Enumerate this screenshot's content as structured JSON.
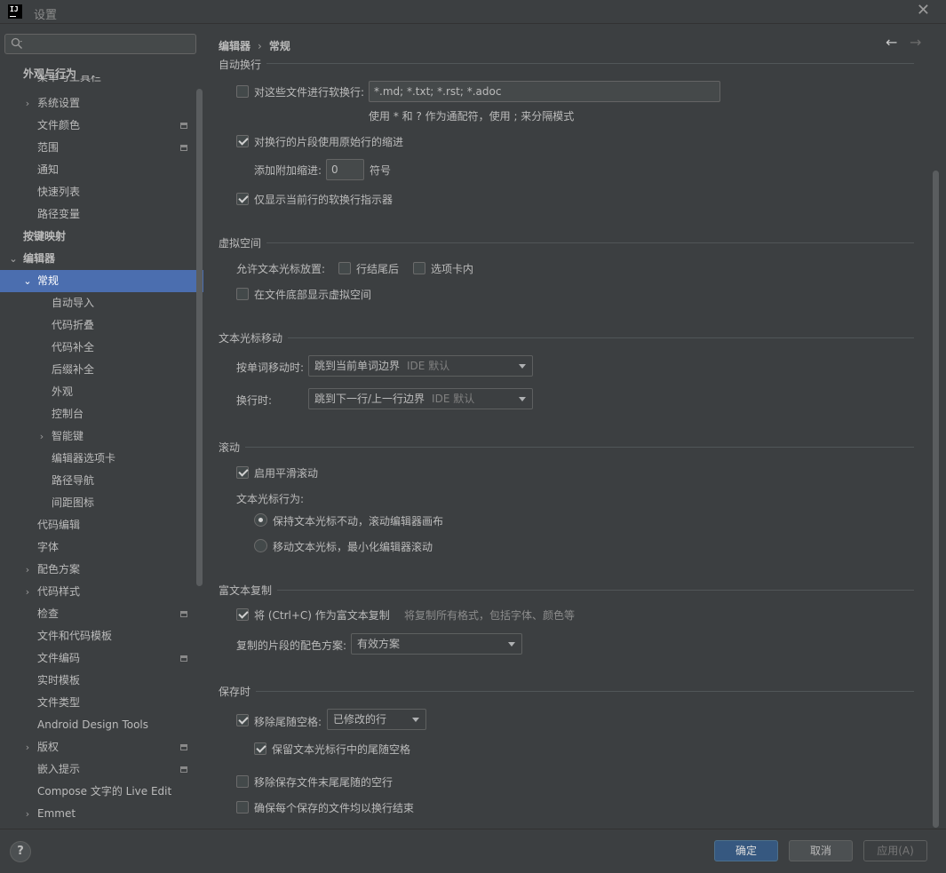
{
  "window": {
    "title": "设置",
    "logo_text": "IJ"
  },
  "search": {
    "placeholder": ""
  },
  "sidebar": {
    "sticky_header": "外观与行为",
    "clipped_item": "菜单与工具栏",
    "items": [
      {
        "label": "系统设置"
      },
      {
        "label": "文件颜色"
      },
      {
        "label": "范围"
      },
      {
        "label": "通知"
      },
      {
        "label": "快速列表"
      },
      {
        "label": "路径变量"
      },
      {
        "label": "按键映射"
      },
      {
        "label": "编辑器"
      },
      {
        "label": "常规"
      },
      {
        "label": "自动导入"
      },
      {
        "label": "代码折叠"
      },
      {
        "label": "代码补全"
      },
      {
        "label": "后缀补全"
      },
      {
        "label": "外观"
      },
      {
        "label": "控制台"
      },
      {
        "label": "智能键"
      },
      {
        "label": "编辑器选项卡"
      },
      {
        "label": "路径导航"
      },
      {
        "label": "间距图标"
      },
      {
        "label": "代码编辑"
      },
      {
        "label": "字体"
      },
      {
        "label": "配色方案"
      },
      {
        "label": "代码样式"
      },
      {
        "label": "检查"
      },
      {
        "label": "文件和代码模板"
      },
      {
        "label": "文件编码"
      },
      {
        "label": "实时模板"
      },
      {
        "label": "文件类型"
      },
      {
        "label": "Android Design Tools"
      },
      {
        "label": "版权"
      },
      {
        "label": "嵌入提示"
      },
      {
        "label": "Compose 文字的 Live Edit"
      },
      {
        "label": "Emmet"
      }
    ]
  },
  "breadcrumb": {
    "parent": "编辑器",
    "separator": "›",
    "current": "常规"
  },
  "nav": {
    "back": "←",
    "forward": "→"
  },
  "soft_wrap": {
    "title": "自动换行",
    "wrap_files_label": "对这些文件进行软换行:",
    "wrap_files_checked": false,
    "wrap_files_value": "*.md; *.txt; *.rst; *.adoc",
    "wrap_files_hint": "使用 * 和 ? 作为通配符，使用 ; 来分隔模式",
    "use_original_indent_label": "对换行的片段使用原始行的缩进",
    "use_original_indent_checked": true,
    "extra_indent_label": "添加附加缩进:",
    "extra_indent_value": "0",
    "extra_indent_unit": "符号",
    "show_indicator_label": "仅显示当前行的软换行指示器",
    "show_indicator_checked": true
  },
  "virtual_space": {
    "title": "虚拟空间",
    "allow_caret_label": "允许文本光标放置:",
    "after_line_end_label": "行结尾后",
    "after_line_end_checked": false,
    "inside_tabs_label": "选项卡内",
    "inside_tabs_checked": false,
    "show_at_bottom_label": "在文件底部显示虚拟空间",
    "show_at_bottom_checked": false
  },
  "caret_movement": {
    "title": "文本光标移动",
    "word_move_label": "按单词移动时:",
    "word_move_value": "跳到当前单词边界",
    "word_move_hint": "IDE 默认",
    "line_change_label": "换行时:",
    "line_change_value": "跳到下一行/上一行边界",
    "line_change_hint": "IDE 默认"
  },
  "scrolling": {
    "title": "滚动",
    "smooth_label": "启用平滑滚动",
    "smooth_checked": true,
    "caret_behavior_label": "文本光标行为:",
    "keep_caret_label": "保持文本光标不动，滚动编辑器画布",
    "keep_caret_checked": true,
    "move_caret_label": "移动文本光标，最小化编辑器滚动",
    "move_caret_checked": false
  },
  "rich_copy": {
    "title": "富文本复制",
    "enable_label": "将 (Ctrl+C) 作为富文本复制",
    "enable_checked": true,
    "enable_hint": "将复制所有格式，包括字体、颜色等",
    "scheme_label": "复制的片段的配色方案:",
    "scheme_value": "有效方案"
  },
  "on_save": {
    "title": "保存时",
    "strip_trailing_label": "移除尾随空格:",
    "strip_trailing_checked": true,
    "strip_trailing_value": "已修改的行",
    "keep_caret_spaces_label": "保留文本光标行中的尾随空格",
    "keep_caret_spaces_checked": true,
    "remove_blank_lines_label": "移除保存文件末尾尾随的空行",
    "remove_blank_lines_checked": false,
    "ensure_newline_label": "确保每个保存的文件均以换行结束",
    "ensure_newline_checked": false
  },
  "footer": {
    "help": "?",
    "ok": "确定",
    "cancel": "取消",
    "apply": "应用(A)"
  },
  "colors": {
    "selection": "#4b6eaf",
    "primary_button": "#365880",
    "background": "#3c3f41"
  },
  "icons": [
    "search-icon",
    "chevron-right-icon",
    "chevron-down-icon",
    "project-scope-icon",
    "arrow-left-icon",
    "arrow-right-icon",
    "close-icon",
    "help-icon"
  ]
}
